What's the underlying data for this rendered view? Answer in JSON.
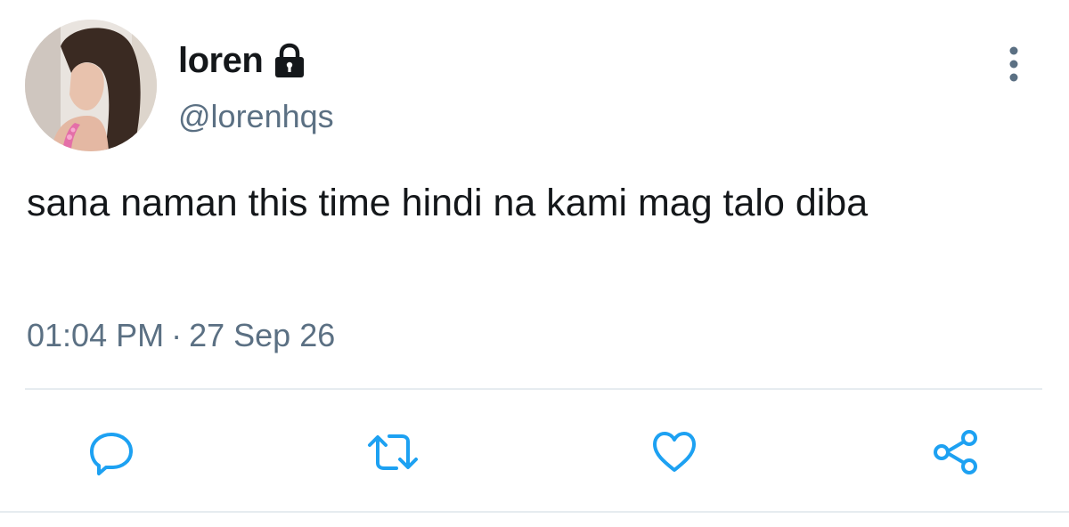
{
  "author": {
    "display_name": "loren",
    "handle": "@lorenhqs",
    "protected": true,
    "lock_icon": "lock-icon",
    "avatar": "profile-photo"
  },
  "tweet": {
    "text": "sana naman this time hindi na kami mag talo diba",
    "time": "01:04 PM",
    "separator": "·",
    "date": "27 Sep 26"
  },
  "actions": [
    {
      "icon": "reply-icon"
    },
    {
      "icon": "retweet-icon"
    },
    {
      "icon": "like-icon"
    },
    {
      "icon": "share-icon"
    }
  ],
  "menu": {
    "icon": "more-options-icon"
  },
  "colors": {
    "text_primary": "#14171a",
    "text_secondary": "#5b7083",
    "accent": "#1da1f2",
    "divider": "#e6ecf0"
  }
}
